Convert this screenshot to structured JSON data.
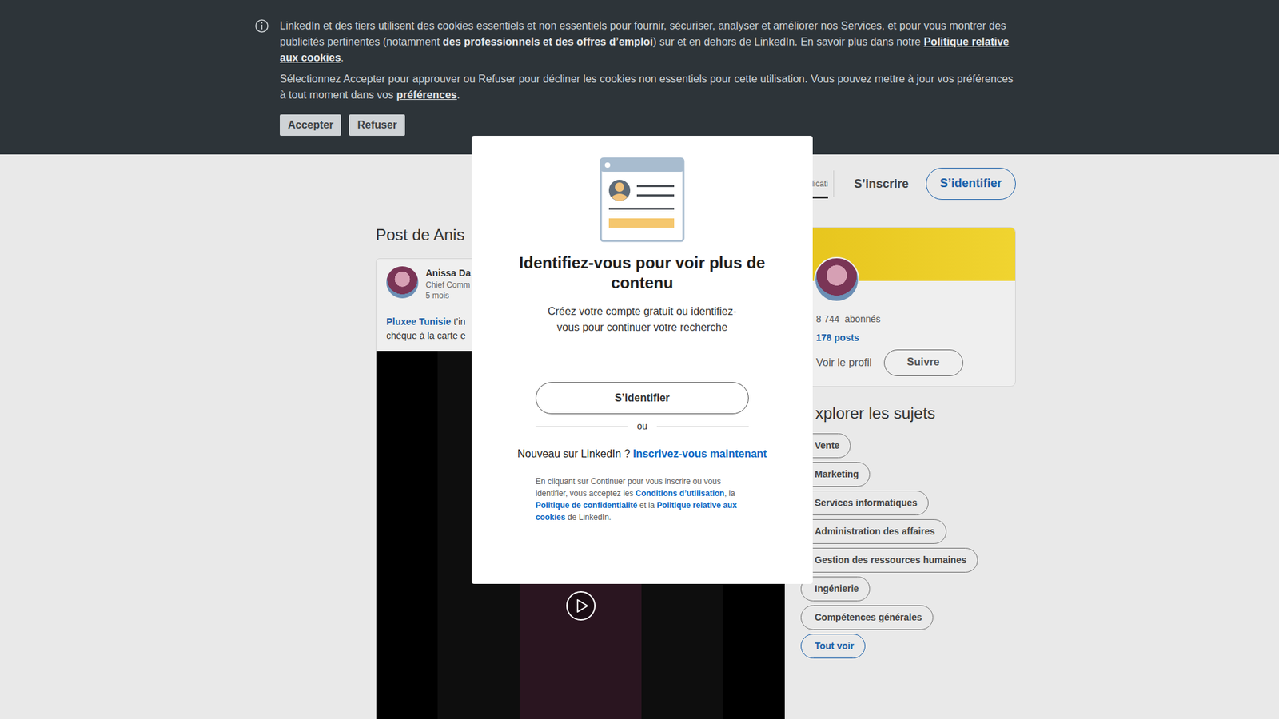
{
  "cookie_banner": {
    "paragraphs": [
      [
        {
          "kind": "text",
          "text": "LinkedIn et des tiers utilisent des cookies essentiels et non essentiels pour fournir, sécuriser, analyser et améliorer nos Services, et pour vous montrer des publicités pertinentes (notamment "
        },
        {
          "kind": "bold",
          "text": "des professionnels et des offres d’emploi"
        },
        {
          "kind": "text",
          "text": ") sur et en dehors de LinkedIn. En savoir plus dans notre "
        },
        {
          "kind": "link",
          "text": "Politique relative aux cookies"
        },
        {
          "kind": "text",
          "text": "."
        }
      ],
      [
        {
          "kind": "text",
          "text": "Sélectionnez Accepter pour approuver ou Refuser pour décliner les cookies non essentiels pour cette utilisation. Vous pouvez mettre à jour vos préférences à tout moment dans vos "
        },
        {
          "kind": "link",
          "text": "préférences"
        },
        {
          "kind": "text",
          "text": "."
        }
      ]
    ],
    "buttons": [
      "Accepter",
      "Refuser"
    ]
  },
  "header": {
    "tab": {
      "label": "l'applicati",
      "selected": true
    },
    "signup": "S’inscrire",
    "signin": "S’identifier"
  },
  "post": {
    "heading": "Post de Anis",
    "author": "Anissa Da",
    "headline": "Chief Comm",
    "time": "5 mois",
    "lines": [
      [
        {
          "kind": "link",
          "text": "Pluxee Tunisie"
        },
        {
          "kind": "text",
          "text": " t’in"
        }
      ],
      [
        {
          "kind": "text",
          "text": "chèque à la carte e"
        }
      ]
    ]
  },
  "profile": {
    "followers": "8 744",
    "followers_label": "abonnés",
    "posts": "178 posts",
    "view": "Voir le profil",
    "follow": "Suivre"
  },
  "topics": {
    "title": "xplorer les sujets",
    "items": [
      {
        "label": "Vente",
        "kind": "topic"
      },
      {
        "label": "Marketing",
        "kind": "topic"
      },
      {
        "label": "Services informatiques",
        "kind": "topic"
      },
      {
        "label": "Administration des affaires",
        "kind": "topic"
      },
      {
        "label": "Gestion des ressources humaines",
        "kind": "topic"
      },
      {
        "label": "Ingénierie",
        "kind": "topic"
      },
      {
        "label": "Compétences générales",
        "kind": "topic"
      },
      {
        "label": "Tout voir",
        "kind": "more"
      }
    ]
  },
  "modal": {
    "title": "Identifiez-vous pour voir plus de contenu",
    "subtitle": "Créez votre compte gratuit ou identifiez-vous pour continuer votre recherche",
    "signin": "S’identifier",
    "divider": "ou",
    "new_prompt": "Nouveau sur LinkedIn ? ",
    "signup_link": "Inscrivez-vous maintenant",
    "legal": [
      {
        "kind": "text",
        "text": "En cliquant sur Continuer pour vous inscrire ou vous identifier, vous acceptez les "
      },
      {
        "kind": "link",
        "text": "Conditions d’utilisation"
      },
      {
        "kind": "text",
        "text": ", la "
      },
      {
        "kind": "link",
        "text": "Politique de confidentialité"
      },
      {
        "kind": "text",
        "text": " et la "
      },
      {
        "kind": "link",
        "text": "Politique relative aux cookies"
      },
      {
        "kind": "text",
        "text": " de LinkedIn."
      }
    ]
  }
}
